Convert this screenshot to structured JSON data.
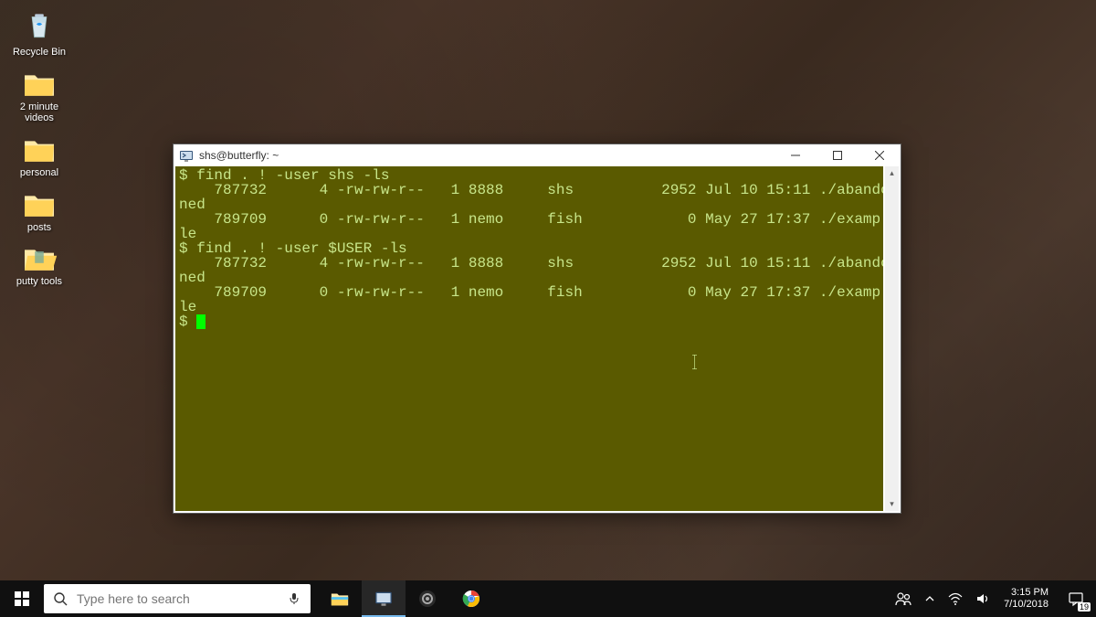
{
  "desktop": {
    "icons": [
      {
        "label": "Recycle Bin",
        "kind": "recycle"
      },
      {
        "label": "2 minute videos",
        "kind": "folder"
      },
      {
        "label": "personal",
        "kind": "folder"
      },
      {
        "label": "posts",
        "kind": "folder"
      },
      {
        "label": "putty tools",
        "kind": "folder-open"
      }
    ]
  },
  "putty": {
    "title": "shs@butterfly: ~",
    "terminal_lines": [
      "$ find . ! -user shs -ls",
      "    787732      4 -rw-rw-r--   1 8888     shs          2952 Jul 10 15:11 ./abando",
      "ned",
      "    789709      0 -rw-rw-r--   1 nemo     fish            0 May 27 17:37 ./examp",
      "le",
      "$ find . ! -user $USER -ls",
      "    787732      4 -rw-rw-r--   1 8888     shs          2952 Jul 10 15:11 ./abando",
      "ned",
      "    789709      0 -rw-rw-r--   1 nemo     fish            0 May 27 17:37 ./examp",
      "le"
    ],
    "prompt": "$ "
  },
  "taskbar": {
    "search_placeholder": "Type here to search",
    "clock_time": "3:15 PM",
    "clock_date": "7/10/2018",
    "notification_count": "19"
  }
}
